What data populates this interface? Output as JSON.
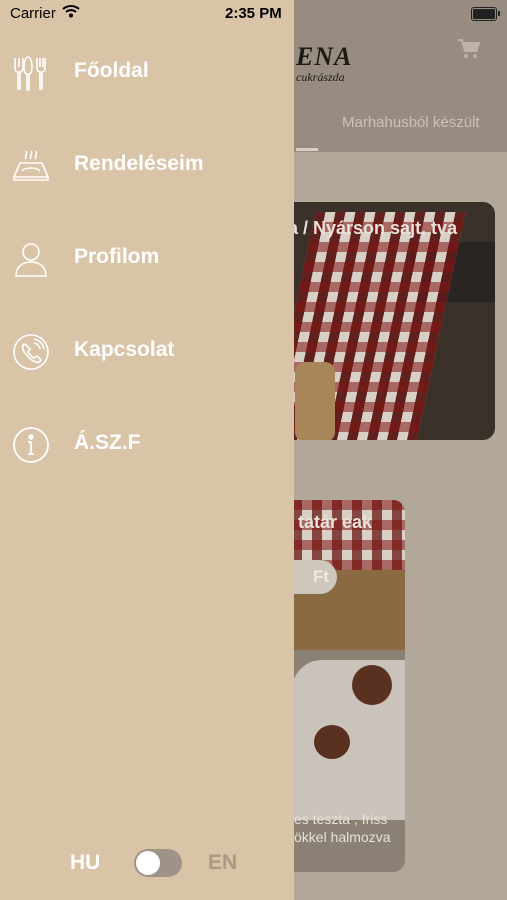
{
  "status_bar": {
    "carrier": "Carrier",
    "time": "2:35 PM",
    "battery_level": 1.0
  },
  "app": {
    "logo": "ENA",
    "logo_subtitle": "cukrászda",
    "active_tab": "Marhahusból készült",
    "products": [
      {
        "title": "a / Nyárson sajt, tva"
      },
      {
        "title": "tatár eak",
        "price": "Ft",
        "description": "es teszta , friss ökkel halmozva"
      }
    ]
  },
  "drawer": {
    "menu": [
      {
        "label": "Főoldal",
        "icon": "cutlery-icon"
      },
      {
        "label": "Rendeléseim",
        "icon": "food-tray-icon"
      },
      {
        "label": "Profilom",
        "icon": "profile-icon"
      },
      {
        "label": "Kapcsolat",
        "icon": "phone-icon"
      },
      {
        "label": "Á.SZ.F",
        "icon": "info-icon"
      }
    ],
    "language": {
      "left": "HU",
      "right": "EN",
      "english_selected": false
    }
  }
}
